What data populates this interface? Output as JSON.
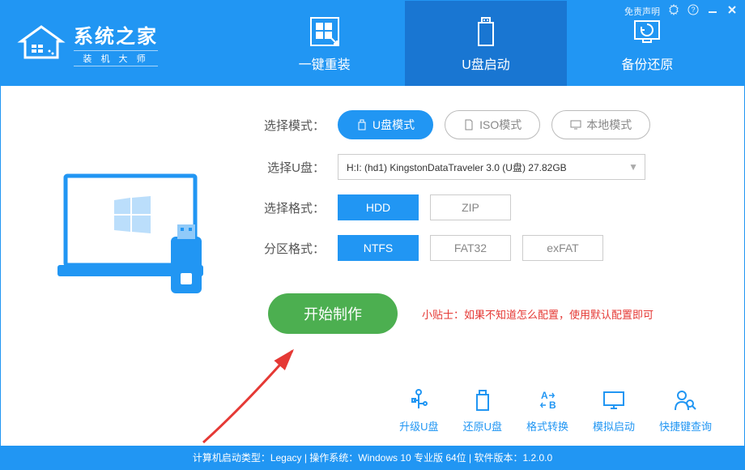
{
  "header": {
    "logo_title": "系统之家",
    "logo_subtitle": "装 机 大 师",
    "disclaimer": "免责声明"
  },
  "tabs": [
    {
      "label": "一键重装"
    },
    {
      "label": "U盘启动"
    },
    {
      "label": "备份还原"
    }
  ],
  "form": {
    "mode_label": "选择模式：",
    "modes": [
      {
        "label": "U盘模式",
        "active": true
      },
      {
        "label": "ISO模式",
        "active": false
      },
      {
        "label": "本地模式",
        "active": false
      }
    ],
    "udisk_label": "选择U盘：",
    "udisk_value": "H:I: (hd1) KingstonDataTraveler 3.0 (U盘) 27.82GB",
    "format_label": "选择格式：",
    "formats": [
      {
        "label": "HDD",
        "active": true
      },
      {
        "label": "ZIP",
        "active": false
      }
    ],
    "partition_label": "分区格式：",
    "partitions": [
      {
        "label": "NTFS",
        "active": true
      },
      {
        "label": "FAT32",
        "active": false
      },
      {
        "label": "exFAT",
        "active": false
      }
    ],
    "start_button": "开始制作",
    "tip": "小贴士：如果不知道怎么配置，使用默认配置即可"
  },
  "tools": [
    {
      "label": "升级U盘"
    },
    {
      "label": "还原U盘"
    },
    {
      "label": "格式转换"
    },
    {
      "label": "模拟启动"
    },
    {
      "label": "快捷键查询"
    }
  ],
  "status": "计算机启动类型：Legacy | 操作系统：Windows 10 专业版 64位 | 软件版本：1.2.0.0"
}
